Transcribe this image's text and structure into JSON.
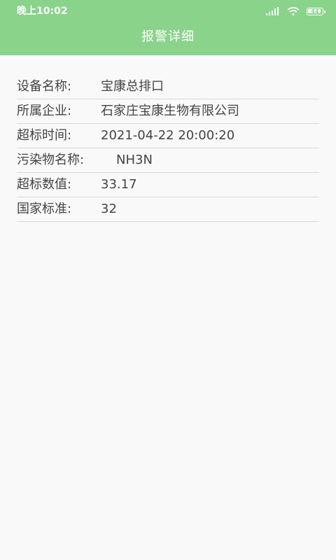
{
  "status_bar": {
    "time": "晚上10:02",
    "battery_level": "44"
  },
  "app_bar": {
    "title": "报警详细"
  },
  "details": [
    {
      "label": "设备名称:",
      "value": "宝康总排口"
    },
    {
      "label": "所属企业:",
      "value": "石家庄宝康生物有限公司"
    },
    {
      "label": "超标时间:",
      "value": "2021-04-22 20:00:20"
    },
    {
      "label": "污染物名称:",
      "value": "NH3N"
    },
    {
      "label": "超标数值:",
      "value": "33.17"
    },
    {
      "label": "国家标准:",
      "value": "32"
    }
  ],
  "colors": {
    "header": "#89d38a",
    "background": "#f9f9f9",
    "text": "#444444",
    "divider": "#d6d6d6"
  }
}
